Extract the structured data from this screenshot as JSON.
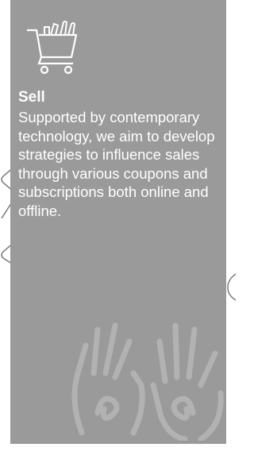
{
  "card": {
    "icon": "shopping-cart-icon",
    "title": "Sell",
    "description": "Supported by contemporary technology, we aim to develop strategies to influence sales through various coupons and subscriptions both online and offline.",
    "watermark": "hands-icon"
  },
  "colors": {
    "card_background": "#9a9a9a",
    "text": "#ffffff",
    "watermark": "#b2b2b2"
  }
}
